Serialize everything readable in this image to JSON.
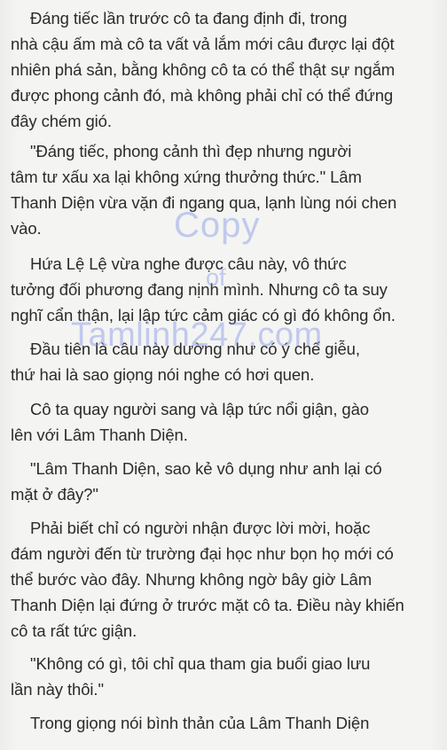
{
  "paragraphs": [
    {
      "lines": [
        "Đáng tiếc lần trước cô ta đang định đi, trong",
        "nhà cậu ấm mà cô ta vất vả lắm mới câu được lại đột",
        "nhiên phá sản, bằng không cô ta có thể thật sự ngắm",
        "được phong cảnh đó, mà không phải chỉ có thể đứng",
        "đây chém gió."
      ]
    },
    {
      "lines": [
        "\"Đáng tiếc, phong cảnh thì đẹp nhưng người",
        "tâm tư xấu xa lại không xứng thưởng thức.\" Lâm",
        "Thanh Diện vừa vặn đi ngang qua, lạnh lùng nói chen",
        "vào."
      ]
    },
    {
      "lines": [
        "Hứa Lệ Lệ vừa nghe được câu này, vô thức",
        "tưởng đối phương đang nịnh mình. Nhưng cô ta suy",
        "nghĩ cẩn thận, lại lập tức cảm giác có gì đó không ổn."
      ]
    },
    {
      "lines": [
        "Đầu tiên là câu này dường như có ý chế giễu,",
        "thứ hai là sao giọng nói nghe có hơi quen."
      ]
    },
    {
      "lines": [
        "Cô ta quay người sang và lập tức nổi giận, gào",
        "lên với Lâm Thanh Diện."
      ]
    },
    {
      "lines": [
        "\"Lâm Thanh Diện, sao kẻ vô dụng như anh lại có",
        "mặt ở đây?\""
      ]
    },
    {
      "lines": [
        "Phải biết chỉ có người nhận được lời mời, hoặc",
        "đám người đến từ trường đại học như bọn họ mới có",
        "thể bước vào đây. Nhưng không ngờ bây giờ Lâm",
        "Thanh Diện lại đứng ở trước mặt cô ta. Điều này khiến",
        "cô ta rất tức giận."
      ]
    },
    {
      "lines": [
        "\"Không có gì, tôi chỉ qua tham gia buổi giao lưu",
        "lần này thôi.\""
      ]
    },
    {
      "lines": [
        "Trong giọng nói bình thản của Lâm Thanh Diện"
      ]
    }
  ],
  "watermark": {
    "line1": "Copy",
    "line2": "of",
    "line3": "Tamlinh247.com"
  }
}
